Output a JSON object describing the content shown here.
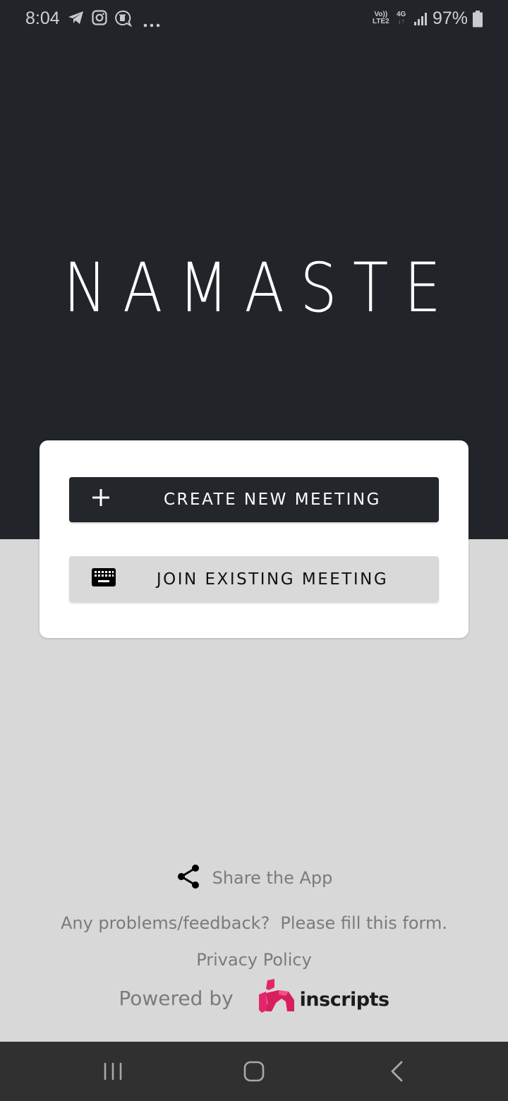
{
  "status_bar": {
    "time": "8:04",
    "notification_icons": [
      "telegram-icon",
      "instagram-icon",
      "chat-bubble-icon",
      "more-dots-icon"
    ],
    "volte_line1": "Vo))",
    "volte_line2": "LTE2",
    "network_type": "4G",
    "network_arrows": "↓↑",
    "battery_percent": "97%"
  },
  "app": {
    "title": "NAMASTE"
  },
  "card": {
    "create_button": {
      "label": "CREATE NEW MEETING",
      "icon": "plus-icon"
    },
    "join_button": {
      "label": "JOIN EXISTING MEETING",
      "icon": "keyboard-icon"
    }
  },
  "footer": {
    "share_label": "Share the App",
    "feedback_question": "Any problems/feedback?",
    "feedback_link": "Please fill this form.",
    "privacy_label": "Privacy Policy",
    "powered_by_label": "Powered by",
    "brand_name": "inscripts"
  },
  "colors": {
    "header_bg": "#212429",
    "page_bg": "#d8d8d8",
    "primary_button": "#23262b",
    "secondary_button": "#d9d9d9",
    "brand_pink": "#e3266b",
    "footer_text": "#7b7b7b"
  },
  "nav_bar": {
    "buttons": [
      "recent-apps",
      "home",
      "back"
    ]
  }
}
